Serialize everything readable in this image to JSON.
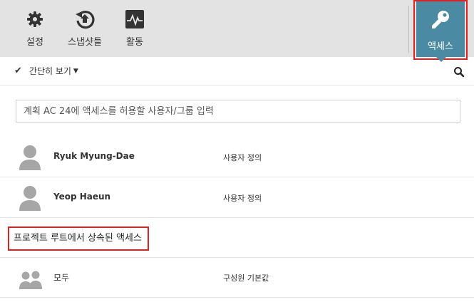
{
  "toolbar": {
    "settings_label": "설정",
    "snapshots_label": "스냅샷들",
    "activity_label": "활동",
    "access_label": "액세스"
  },
  "icons": {
    "settings": "gear-icon",
    "snapshots": "history-icon",
    "activity": "activity-pulse-icon",
    "access": "key-icon",
    "search": "search-icon",
    "user": "user-icon",
    "group": "group-icon"
  },
  "colors": {
    "toolbar_bg": "#e3e3e3",
    "access_active_bg": "#4a8aa3",
    "highlight_border": "#e02020",
    "avatar": "#a6a6a6"
  },
  "viewbar": {
    "toggle_label": "간단히 보기"
  },
  "entry": {
    "placeholder": "계획 AC 24에 액세스를 허용할 사용자/그룹 입력"
  },
  "users": [
    {
      "name": "Ryuk Myung-Dae",
      "role": "사용자 정의"
    },
    {
      "name": "Yeop Haeun",
      "role": "사용자 정의"
    }
  ],
  "inherited": {
    "heading": "프로젝트 루트에서 상속된 액세스",
    "items": [
      {
        "name": "모두",
        "role": "구성원 기본값"
      }
    ]
  }
}
